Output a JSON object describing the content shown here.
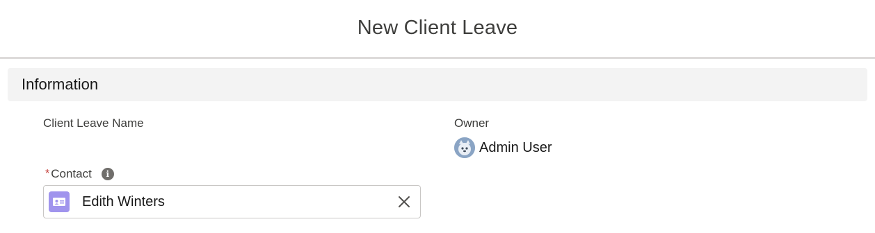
{
  "modal": {
    "title": "New Client Leave"
  },
  "section": {
    "title": "Information"
  },
  "fields": {
    "client_leave_name": {
      "label": "Client Leave Name"
    },
    "owner": {
      "label": "Owner",
      "value": "Admin User",
      "avatar_icon": "admin-avatar-icon"
    },
    "contact": {
      "required_marker": "*",
      "label": "Contact",
      "info_icon": "info-icon",
      "value": "Edith Winters",
      "record_icon": "contact-card-icon",
      "clear_icon": "close-icon"
    }
  },
  "colors": {
    "required": "#c23934",
    "contact_icon_bg": "#a094ed",
    "section_bg": "#f3f3f3",
    "header_border": "#dddbda"
  }
}
